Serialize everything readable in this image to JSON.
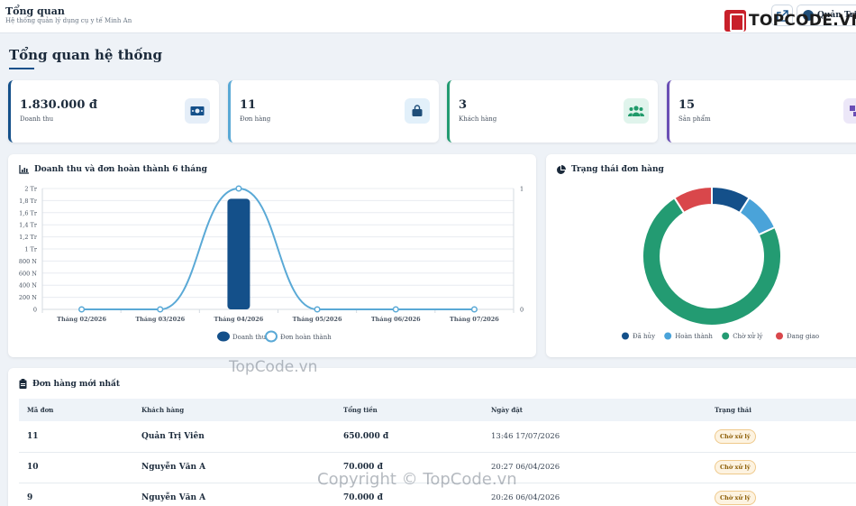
{
  "header": {
    "title": "Tổng quan",
    "subtitle": "Hệ thống quản lý dụng cụ y tế Minh An",
    "user_name": "Quản Trị"
  },
  "logo": {
    "text_main": "TOPCODE",
    "text_suffix": ".VN"
  },
  "page": {
    "heading": "Tổng quan hệ thống"
  },
  "stats": [
    {
      "value": "1.830.000 đ",
      "label": "Doanh thu",
      "icon": "money-icon",
      "color": "#14508a",
      "bg": "#e5eef8"
    },
    {
      "value": "11",
      "label": "Đơn hàng",
      "icon": "shopping-bag-icon",
      "color": "#1f7bb5",
      "bg": "#e2f0fa"
    },
    {
      "value": "3",
      "label": "Khách hàng",
      "icon": "users-icon",
      "color": "#1f9a6a",
      "bg": "#e0f4ec"
    },
    {
      "value": "15",
      "label": "Sản phẩm",
      "icon": "boxes-icon",
      "color": "#6a4fb5",
      "bg": "#ece7f8"
    }
  ],
  "revenue_panel": {
    "title": "Doanh thu và đơn hoàn thành 6 tháng"
  },
  "status_panel": {
    "title": "Trạng thái đơn hàng"
  },
  "chart_data": [
    {
      "type": "bar",
      "title": "Doanh thu và đơn hoàn thành 6 tháng",
      "categories": [
        "Tháng 02/2026",
        "Tháng 03/2026",
        "Tháng 04/2026",
        "Tháng 05/2026",
        "Tháng 06/2026",
        "Tháng 07/2026"
      ],
      "series": [
        {
          "name": "Doanh thu",
          "type": "bar",
          "axis": "left",
          "values": [
            0,
            0,
            1830000,
            0,
            0,
            0
          ],
          "color": "#14508a"
        },
        {
          "name": "Đơn hoàn thành",
          "type": "line",
          "axis": "right",
          "values": [
            0,
            0,
            1,
            0,
            0,
            0
          ],
          "color": "#5aa9d6"
        }
      ],
      "y_left_ticks": [
        "0",
        "200 N",
        "400 N",
        "600 N",
        "800 N",
        "1 Tr",
        "1,2 Tr",
        "1,4 Tr",
        "1,6 Tr",
        "1,8 Tr",
        "2 Tr"
      ],
      "y_right_ticks": [
        "0",
        "1"
      ],
      "ylim": [
        0,
        2000000
      ],
      "y2lim": [
        0,
        1
      ],
      "grid": true,
      "legend": "bottom"
    },
    {
      "type": "pie",
      "title": "Trạng thái đơn hàng",
      "labels": [
        "Đã hủy",
        "Hoàn thành",
        "Chờ xử lý",
        "Đang giao"
      ],
      "values": [
        1,
        1,
        8,
        1
      ],
      "colors": [
        "#14508a",
        "#4aa3d9",
        "#239b72",
        "#d9474b"
      ],
      "legend": "bottom"
    }
  ],
  "orders_panel": {
    "title": "Đơn hàng mới nhất",
    "columns": [
      "Mã đơn",
      "Khách hàng",
      "Tổng tiền",
      "Ngày đặt",
      "Trạng thái"
    ],
    "rows": [
      {
        "id": "11",
        "customer": "Quản Trị Viên",
        "total": "650.000 đ",
        "date": "13:46 17/07/2026",
        "status": "Chờ xử lý"
      },
      {
        "id": "10",
        "customer": "Nguyễn Văn A",
        "total": "70.000 đ",
        "date": "20:27 06/04/2026",
        "status": "Chờ xử lý"
      },
      {
        "id": "9",
        "customer": "Nguyễn Văn A",
        "total": "70.000 đ",
        "date": "20:26 06/04/2026",
        "status": "Chờ xử lý"
      }
    ]
  },
  "watermarks": {
    "mid": "TopCode.vn",
    "bottom": "Copyright © TopCode.vn"
  }
}
